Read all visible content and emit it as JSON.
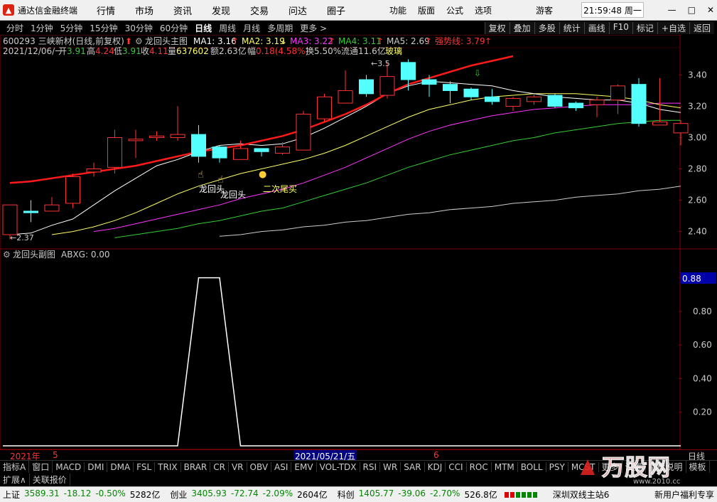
{
  "app": {
    "title": "通达信金融终端"
  },
  "menu": [
    "行情",
    "市场",
    "资讯",
    "发现",
    "交易",
    "问达",
    "圈子"
  ],
  "menu_right": [
    "功能",
    "版面",
    "公式",
    "选项"
  ],
  "guest": "游客",
  "clock": "21:59:48 周一",
  "period_tabs": [
    "分时",
    "1分钟",
    "5分钟",
    "15分钟",
    "30分钟",
    "60分钟",
    "日线",
    "周线",
    "月线",
    "多周期",
    "更多 >"
  ],
  "active_period": "日线",
  "right_tools": [
    "复权",
    "叠加",
    "多股",
    "统计",
    "画线",
    "F10",
    "标记",
    "+自选",
    "返回"
  ],
  "stock": {
    "header1": "600293 三峡新材(日线,前复权)",
    "indicator_name": "龙回头主图",
    "ma1": "MA1: 3.16",
    "ma2": "MA2: 3.19",
    "ma3": "MA3: 3.22",
    "ma4": "MA4: 3.11",
    "ma5": "MA5: 2.69",
    "strong": "强势线: 3.79",
    "date": "2021/12/06/一",
    "open_l": "开",
    "open": "3.91",
    "high_l": "高",
    "high": "4.24",
    "low_l": "低",
    "low": "3.91",
    "close_l": "收",
    "close": "4.11",
    "vol_l": "量",
    "vol": "637602",
    "amt": "额2.63亿",
    "chg_l": "幅",
    "chg": "0.18(4.58%)",
    "turn": "换5.50%",
    "float": "流通11.6亿",
    "sector": "玻璃"
  },
  "signals": {
    "s1": "龙回头",
    "s2": "龙回头",
    "s3": "二次尾买",
    "low_label": "2.37",
    "high_label": "3.5"
  },
  "sub": {
    "name": "龙回头副图",
    "abxg": "ABXG: 0.00",
    "current": "0.88"
  },
  "price_axis": [
    "3.40",
    "3.20",
    "3.00",
    "2.80",
    "2.60",
    "2.40"
  ],
  "sub_axis": [
    "1.00",
    "0.80",
    "0.60",
    "0.40",
    "0.20"
  ],
  "time_axis": {
    "year": "2021年",
    "m5": "5",
    "cursor": "2021/05/21/五",
    "m6": "6",
    "label": "日线"
  },
  "indicator_tabs": [
    "指标A",
    "窗口",
    "MACD",
    "DMI",
    "DMA",
    "FSL",
    "TRIX",
    "BRAR",
    "CR",
    "VR",
    "OBV",
    "ASI",
    "EMV",
    "VOL-TDX",
    "RSI",
    "WR",
    "SAR",
    "KDJ",
    "CCI",
    "ROC",
    "MTM",
    "BOLL",
    "PSY",
    "MCST",
    "更多",
    "设置",
    "指标说明",
    "模板"
  ],
  "tabs2": [
    "扩展∧",
    "关联报价"
  ],
  "status": {
    "sh_l": "上证",
    "sh": "3589.31",
    "sh_c": "-18.12",
    "sh_p": "-0.50%",
    "sh_a": "5282亿",
    "cy_l": "创业",
    "cy": "3405.93",
    "cy_c": "-72.74",
    "cy_p": "-2.09%",
    "cy_a": "2604亿",
    "kc_l": "科创",
    "kc": "1405.77",
    "kc_c": "-39.06",
    "kc_p": "-2.70%",
    "kc_a": "526.8亿",
    "server": "深圳双线主站6",
    "promo": "新用户福利专享"
  },
  "watermark": {
    "text": "万股网",
    "url": "www.2010.cc"
  },
  "colors": {
    "up": "#ff3333",
    "down": "#54ffff",
    "ma1": "#ffffff",
    "ma2": "#ffff66",
    "ma3": "#ff33ff",
    "ma4": "#33cc33",
    "ma5": "#cccccc",
    "strong": "#ff1a1a"
  },
  "chart_data": {
    "type": "candlestick",
    "y_range": [
      2.33,
      3.52
    ],
    "candles": [
      {
        "o": 2.38,
        "c": 2.57,
        "h": 2.57,
        "l": 2.35
      },
      {
        "o": 2.53,
        "c": 2.52,
        "h": 2.6,
        "l": 2.46
      },
      {
        "o": 2.53,
        "c": 2.57,
        "h": 2.62,
        "l": 2.53
      },
      {
        "o": 2.58,
        "c": 2.75,
        "h": 2.77,
        "l": 2.55
      },
      {
        "o": 2.78,
        "c": 2.8,
        "h": 2.84,
        "l": 2.75
      },
      {
        "o": 2.81,
        "c": 3.0,
        "h": 3.05,
        "l": 2.77
      },
      {
        "o": 2.98,
        "c": 2.99,
        "h": 3.05,
        "l": 2.87
      },
      {
        "o": 3.0,
        "c": 3.01,
        "h": 3.04,
        "l": 2.98
      },
      {
        "o": 3.0,
        "c": 3.02,
        "h": 3.2,
        "l": 2.98
      },
      {
        "o": 3.02,
        "c": 2.88,
        "h": 3.08,
        "l": 2.84
      },
      {
        "o": 2.94,
        "c": 2.87,
        "h": 2.95,
        "l": 2.84
      },
      {
        "o": 2.86,
        "c": 2.93,
        "h": 2.98,
        "l": 2.86
      },
      {
        "o": 2.93,
        "c": 2.91,
        "h": 2.93,
        "l": 2.88
      },
      {
        "o": 2.9,
        "c": 2.94,
        "h": 2.97,
        "l": 2.89
      },
      {
        "o": 2.92,
        "c": 3.15,
        "h": 3.17,
        "l": 2.92
      },
      {
        "o": 3.12,
        "c": 3.26,
        "h": 3.28,
        "l": 3.1
      },
      {
        "o": 3.22,
        "c": 3.3,
        "h": 3.43,
        "l": 3.22
      },
      {
        "o": 3.37,
        "c": 3.28,
        "h": 3.4,
        "l": 3.26
      },
      {
        "o": 3.27,
        "c": 3.39,
        "h": 3.48,
        "l": 3.25
      },
      {
        "o": 3.48,
        "c": 3.37,
        "h": 3.5,
        "l": 3.3
      },
      {
        "o": 3.37,
        "c": 3.34,
        "h": 3.4,
        "l": 3.26
      },
      {
        "o": 3.34,
        "c": 3.3,
        "h": 3.36,
        "l": 3.22
      },
      {
        "o": 3.31,
        "c": 3.26,
        "h": 3.32,
        "l": 3.24
      },
      {
        "o": 3.26,
        "c": 3.23,
        "h": 3.31,
        "l": 3.21
      },
      {
        "o": 3.2,
        "c": 3.25,
        "h": 3.26,
        "l": 3.17
      },
      {
        "o": 3.23,
        "c": 3.26,
        "h": 3.28,
        "l": 3.21
      },
      {
        "o": 3.27,
        "c": 3.2,
        "h": 3.28,
        "l": 3.19
      },
      {
        "o": 3.22,
        "c": 3.19,
        "h": 3.23,
        "l": 3.17
      },
      {
        "o": 3.21,
        "c": 3.24,
        "h": 3.26,
        "l": 3.13
      },
      {
        "o": 3.24,
        "c": 3.33,
        "h": 3.34,
        "l": 3.15
      },
      {
        "o": 3.34,
        "c": 3.09,
        "h": 3.38,
        "l": 3.07
      },
      {
        "o": 3.08,
        "c": 3.1,
        "h": 3.38,
        "l": 3.08
      },
      {
        "o": 3.03,
        "c": 3.09,
        "h": 3.11,
        "l": 2.95
      }
    ],
    "ma1": [
      2.38,
      2.39,
      2.44,
      2.48,
      2.57,
      2.66,
      2.74,
      2.82,
      2.86,
      2.91,
      2.95,
      2.96,
      2.95,
      2.96,
      3.0,
      3.06,
      3.13,
      3.2,
      3.28,
      3.33,
      3.36,
      3.35,
      3.34,
      3.33,
      3.3,
      3.28,
      3.26,
      3.25,
      3.24,
      3.24,
      3.22,
      3.18,
      3.16
    ],
    "ma2": [
      null,
      null,
      2.38,
      2.4,
      2.43,
      2.47,
      2.52,
      2.58,
      2.64,
      2.69,
      2.73,
      2.77,
      2.8,
      2.83,
      2.86,
      2.9,
      2.95,
      3.01,
      3.07,
      3.13,
      3.18,
      3.21,
      3.24,
      3.26,
      3.27,
      3.28,
      3.28,
      3.28,
      3.27,
      3.26,
      3.24,
      3.21,
      3.19
    ],
    "ma3": [
      null,
      null,
      null,
      null,
      2.4,
      2.42,
      2.45,
      2.48,
      2.51,
      2.54,
      2.57,
      2.61,
      2.64,
      2.67,
      2.71,
      2.76,
      2.81,
      2.87,
      2.93,
      2.99,
      3.04,
      3.08,
      3.11,
      3.14,
      3.16,
      3.18,
      3.19,
      3.2,
      3.21,
      3.21,
      3.21,
      3.22,
      3.22
    ],
    "ma4": [
      null,
      null,
      null,
      null,
      null,
      2.36,
      2.38,
      2.4,
      2.42,
      2.45,
      2.47,
      2.5,
      2.53,
      2.55,
      2.59,
      2.63,
      2.67,
      2.71,
      2.76,
      2.81,
      2.85,
      2.89,
      2.92,
      2.95,
      2.98,
      3.0,
      3.03,
      3.05,
      3.07,
      3.09,
      3.1,
      3.11,
      3.11
    ],
    "ma5": [
      null,
      null,
      null,
      null,
      null,
      null,
      null,
      null,
      null,
      null,
      2.37,
      2.38,
      2.4,
      2.41,
      2.43,
      2.44,
      2.46,
      2.47,
      2.49,
      2.51,
      2.52,
      2.54,
      2.55,
      2.56,
      2.58,
      2.59,
      2.6,
      2.62,
      2.63,
      2.64,
      2.66,
      2.67,
      2.69
    ],
    "strong": [
      2.71,
      2.72,
      2.74,
      2.76,
      2.78,
      2.8,
      2.82,
      2.85,
      2.88,
      2.91,
      2.93,
      2.95,
      2.98,
      3.01,
      3.05,
      3.1,
      3.15,
      3.21,
      3.28,
      3.34,
      3.38,
      3.42,
      3.46,
      3.49,
      3.52,
      null,
      null,
      null,
      null,
      null,
      null,
      null,
      null
    ],
    "sub_series": [
      0,
      0,
      0,
      0,
      0,
      0,
      0,
      0,
      0,
      1,
      1,
      0,
      0,
      0,
      0,
      0,
      0,
      0,
      0,
      0,
      0,
      0,
      0,
      0,
      0,
      0,
      0,
      0,
      0,
      0,
      0,
      0,
      0
    ],
    "sub_range": [
      0,
      1.1
    ]
  }
}
